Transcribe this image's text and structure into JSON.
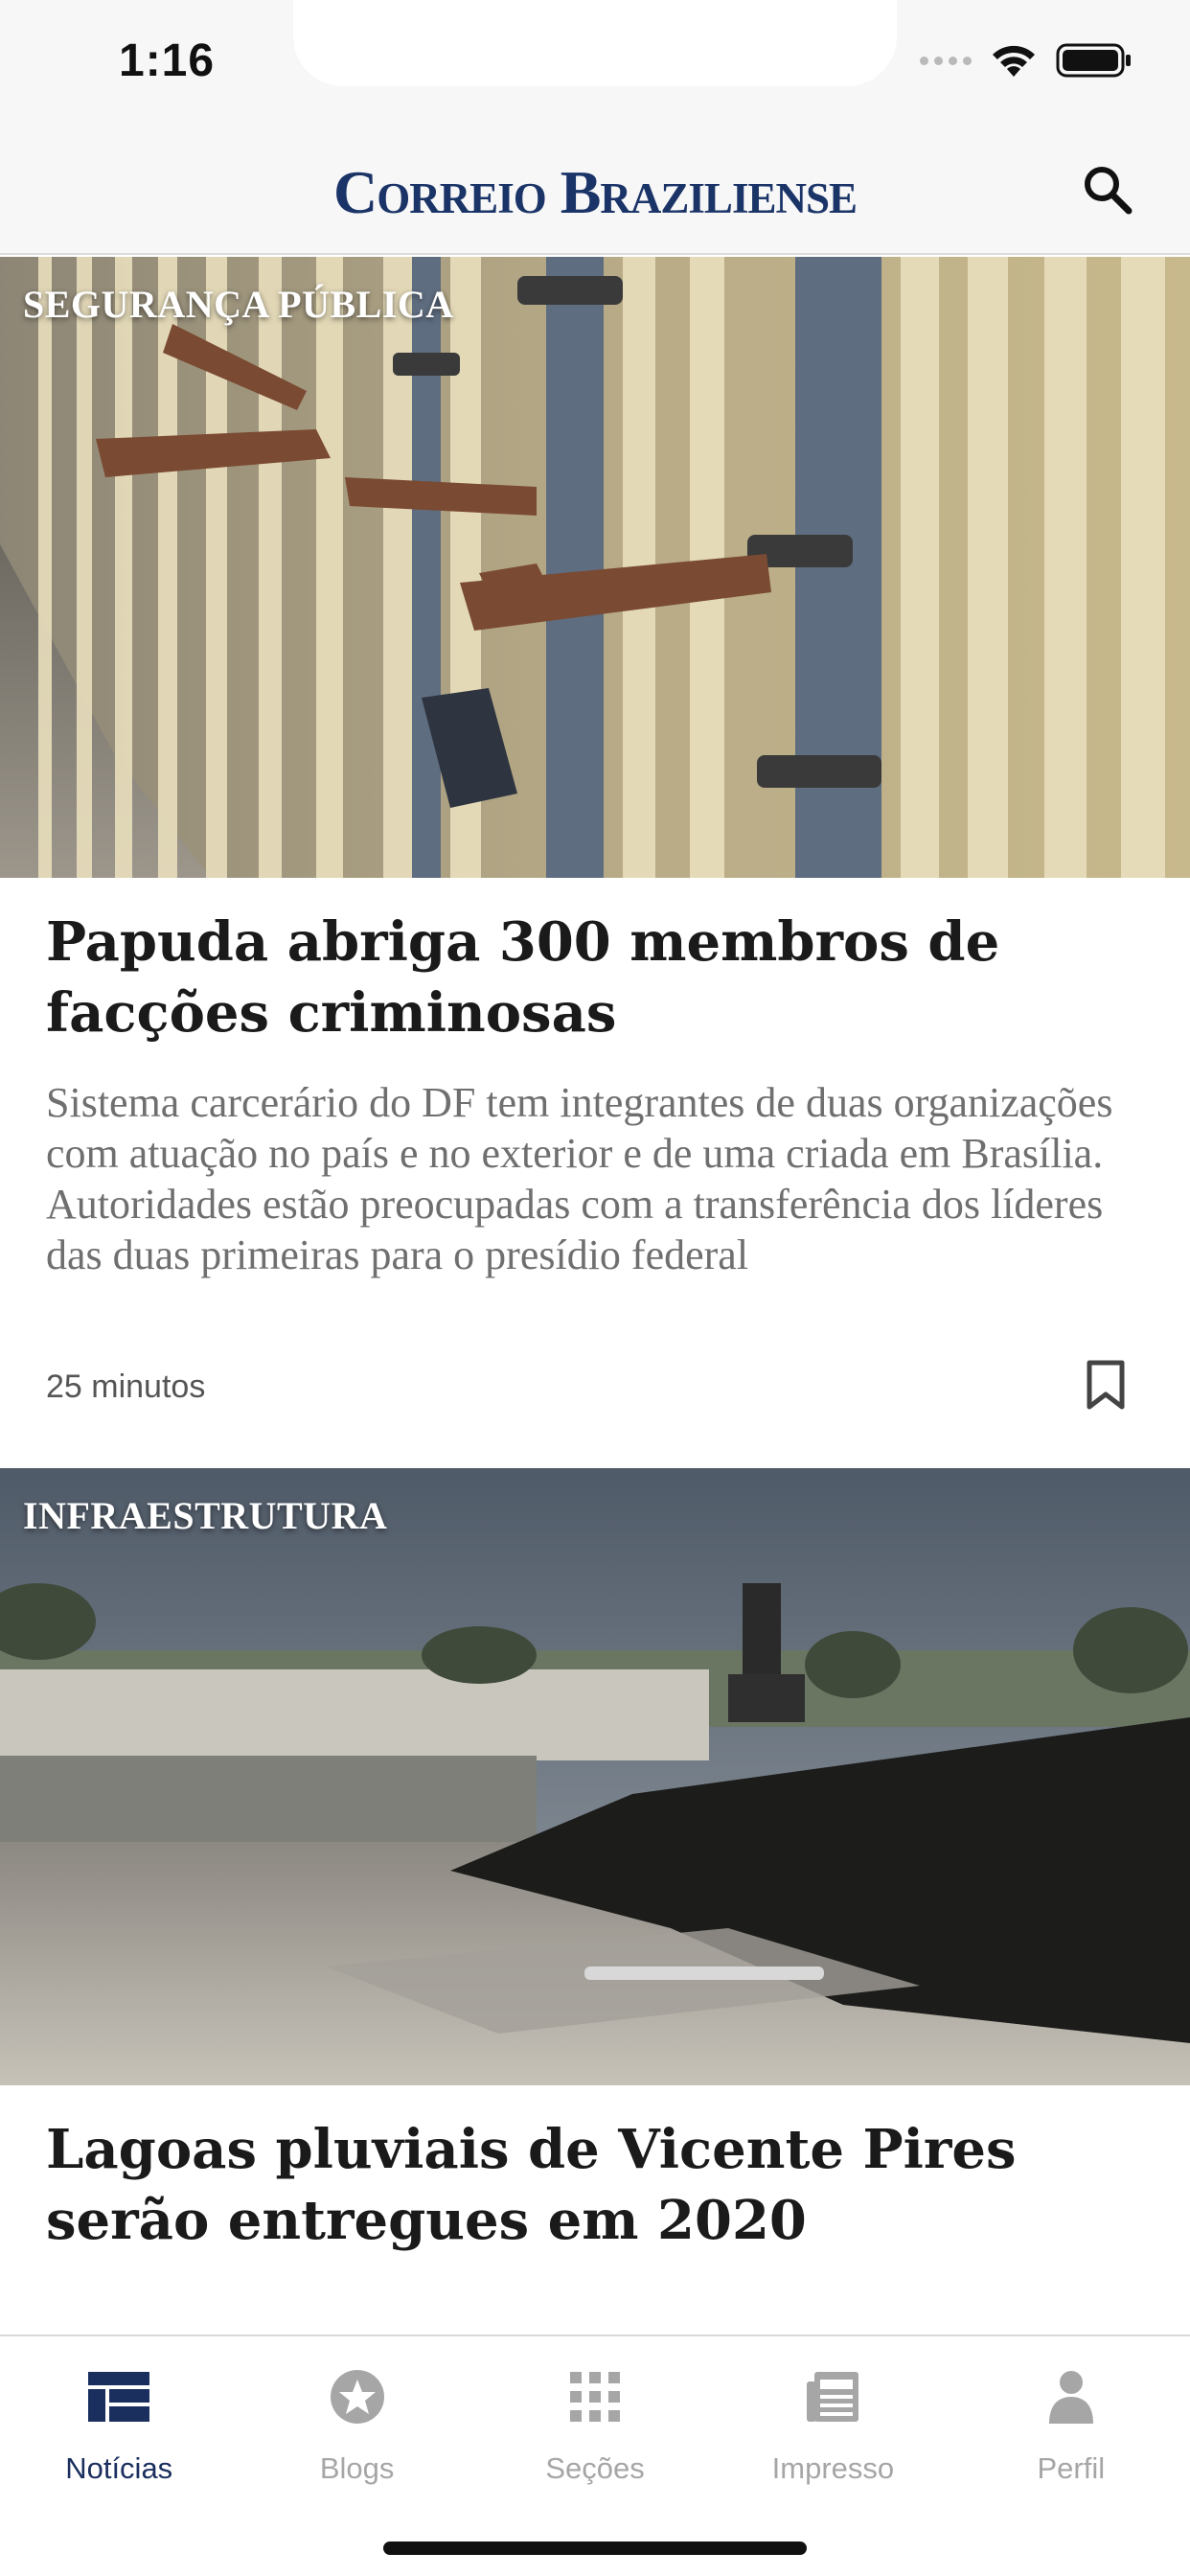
{
  "status_bar": {
    "time": "1:16"
  },
  "header": {
    "logo": "Correio Braziliense",
    "search_icon": "search-icon"
  },
  "articles": [
    {
      "category": "SEGURANÇA PÚBLICA",
      "headline": "Papuda abriga 300 membros de facções criminosas",
      "summary": "Sistema carcerário do DF tem integrantes de duas organizações com atuação no país e no exterior e de uma criada em Brasília. Autoridades estão preocupadas com a transferência dos líderes das duas primeiras para o presídio federal",
      "timestamp": "25 minutos",
      "image": "prison-cell-bars-photo"
    },
    {
      "category": "INFRAESTRUTURA",
      "headline": "Lagoas pluviais de Vicente Pires serão entregues em 2020",
      "image": "construction-site-photo"
    }
  ],
  "tab_bar": {
    "tabs": [
      {
        "label": "Notícias",
        "icon": "news-grid-icon",
        "active": true
      },
      {
        "label": "Blogs",
        "icon": "star-circle-icon",
        "active": false
      },
      {
        "label": "Seções",
        "icon": "grid-dots-icon",
        "active": false
      },
      {
        "label": "Impresso",
        "icon": "newspaper-icon",
        "active": false
      },
      {
        "label": "Perfil",
        "icon": "person-icon",
        "active": false
      }
    ]
  },
  "colors": {
    "brand": "#1b3468",
    "active_tab": "#1b2f5e",
    "inactive_tab": "#a6a6a6"
  }
}
